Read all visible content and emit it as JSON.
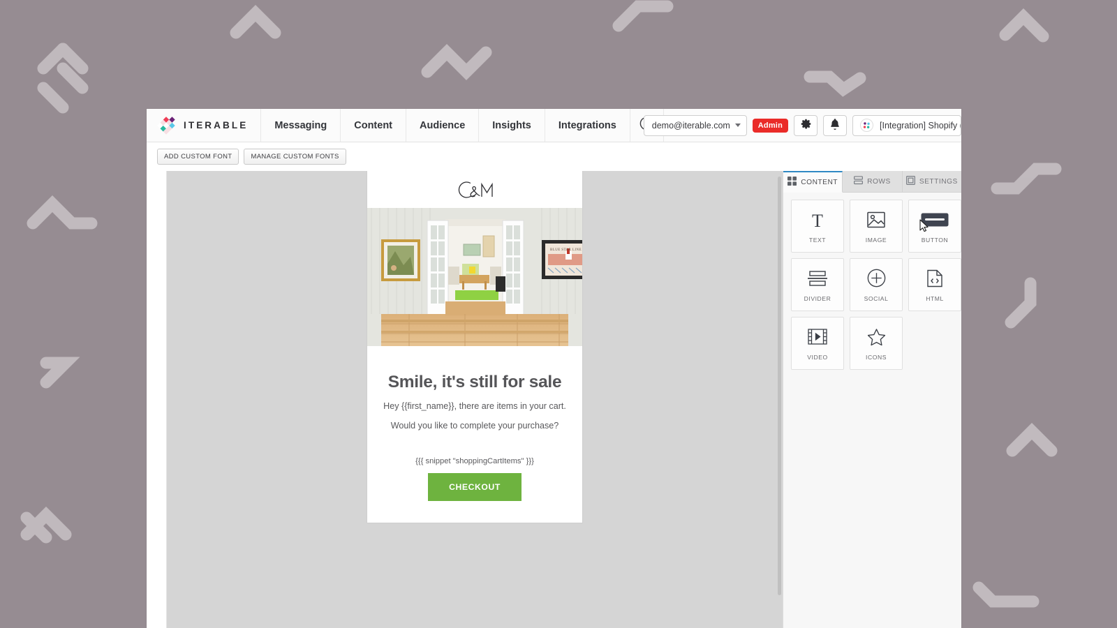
{
  "background": {
    "color": "#968c92",
    "shape_color": "#cfc9cc"
  },
  "header": {
    "brand": {
      "name": "ITERABLE",
      "logo_icon": "iterable-diamond-logo"
    },
    "nav_items": [
      {
        "label": "Messaging"
      },
      {
        "label": "Content"
      },
      {
        "label": "Audience"
      },
      {
        "label": "Insights"
      },
      {
        "label": "Integrations"
      }
    ],
    "help_icon": "question-circle-icon",
    "account": {
      "value": "demo@iterable.com",
      "caret_icon": "chevron-down-icon"
    },
    "admin_badge": "Admin",
    "settings_icon": "gear-icon",
    "notifications_icon": "bell-icon",
    "project": {
      "label": "[Integration] Shopify (C",
      "icon": "iterable-project-icon"
    }
  },
  "toolbar": {
    "add_font_label": "ADD CUSTOM FONT",
    "manage_fonts_label": "MANAGE CUSTOM FONTS"
  },
  "email": {
    "logo_text": "C&M",
    "hero_alt": "interior-room-photo",
    "headline": "Smile, it's still for sale",
    "paragraph_1": "Hey {{first_name}}, there are items in your cart.",
    "paragraph_2": "Would you like to complete your purchase?",
    "snippet": "{{{ snippet \"shoppingCartItems\" }}}",
    "cta_label": "CHECKOUT",
    "cta_color": "#6eb33f"
  },
  "panel": {
    "tabs": [
      {
        "label": "CONTENT",
        "icon": "grid-icon",
        "active": true
      },
      {
        "label": "ROWS",
        "icon": "rows-icon",
        "active": false
      },
      {
        "label": "SETTINGS",
        "icon": "settings-square-icon",
        "active": false
      }
    ],
    "tiles": [
      {
        "label": "TEXT",
        "icon": "text-t-icon"
      },
      {
        "label": "IMAGE",
        "icon": "image-icon"
      },
      {
        "label": "BUTTON",
        "icon": "button-icon"
      },
      {
        "label": "DIVIDER",
        "icon": "divider-icon"
      },
      {
        "label": "SOCIAL",
        "icon": "plus-circle-icon"
      },
      {
        "label": "HTML",
        "icon": "code-file-icon"
      },
      {
        "label": "VIDEO",
        "icon": "video-film-icon"
      },
      {
        "label": "ICONS",
        "icon": "star-icon"
      }
    ]
  },
  "cursor": {
    "icon": "mouse-pointer-icon"
  }
}
